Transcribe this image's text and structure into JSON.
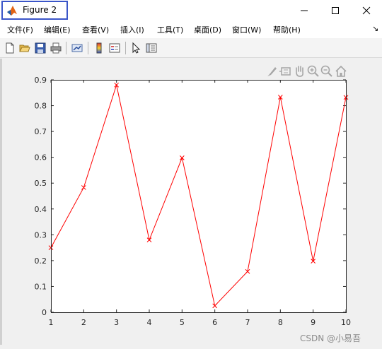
{
  "window": {
    "title": "Figure 2"
  },
  "menu": [
    {
      "label": "文件(F)"
    },
    {
      "label": "编辑(E)"
    },
    {
      "label": "查看(V)"
    },
    {
      "label": "插入(I)"
    },
    {
      "label": "工具(T)"
    },
    {
      "label": "桌面(D)"
    },
    {
      "label": "窗口(W)"
    },
    {
      "label": "帮助(H)"
    }
  ],
  "menu_overflow": "↘",
  "toolbar_icons": [
    "new-figure-icon",
    "open-file-icon",
    "save-icon",
    "print-icon",
    "link-plot-icon",
    "insert-colorbar-icon",
    "insert-legend-icon",
    "edit-plot-icon",
    "property-inspector-icon"
  ],
  "axes_toolbar_icons": [
    "brush-icon",
    "data-tips-icon",
    "pan-icon",
    "zoom-in-icon",
    "zoom-out-icon",
    "home-icon"
  ],
  "colors": {
    "line": "#ff0000",
    "title_highlight": "#3a55c8"
  },
  "chart_data": {
    "type": "line",
    "x": [
      1,
      2,
      3,
      4,
      5,
      6,
      7,
      8,
      9,
      10
    ],
    "series": [
      {
        "values": [
          0.25,
          0.483,
          0.88,
          0.28,
          0.598,
          0.025,
          0.158,
          0.833,
          0.198,
          0.832
        ],
        "marker": "x"
      }
    ],
    "xlim": [
      1,
      10
    ],
    "ylim": [
      0,
      0.9
    ],
    "xticks": [
      "1",
      "2",
      "3",
      "4",
      "5",
      "6",
      "7",
      "8",
      "9",
      "10"
    ],
    "yticks": [
      "0",
      "0.1",
      "0.2",
      "0.3",
      "0.4",
      "0.5",
      "0.6",
      "0.7",
      "0.8",
      "0.9"
    ],
    "grid": false
  },
  "watermark": "CSDN @小易吾"
}
